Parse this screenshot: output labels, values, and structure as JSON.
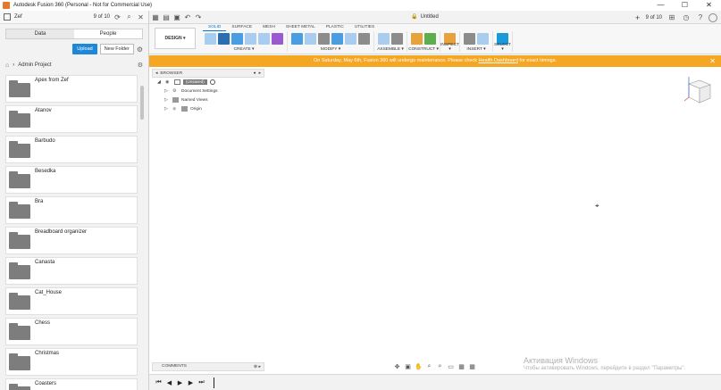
{
  "window": {
    "title": "Autodesk Fusion 360 (Personal - Not for Commercial Use)",
    "minimize": "—",
    "maximize": "☐",
    "close": "✕"
  },
  "data_panel": {
    "user": "Zef",
    "count": "9 of 10",
    "tabs": [
      "Data",
      "People"
    ],
    "upload_label": "Upload",
    "new_folder_label": "New Folder",
    "project_name": "Admin Project",
    "folders": [
      "Apex from Zef",
      "Atanov",
      "Barbudo",
      "Besedka",
      "Bra",
      "Breadboard organizer",
      "Canasta",
      "Cat_House",
      "Chess",
      "Christmas",
      "Coasters"
    ]
  },
  "document": {
    "tab_title": "Untitled",
    "count": "9 of 10"
  },
  "toolbar": {
    "design_label": "DESIGN ▾",
    "workspace_tabs": [
      "SOLID",
      "SURFACE",
      "MESH",
      "SHEET METAL",
      "PLASTIC",
      "UTILITIES"
    ],
    "groups": [
      "CREATE ▾",
      "MODIFY ▾",
      "ASSEMBLE ▾",
      "CONSTRUCT ▾",
      "INSPECT ▾",
      "INSERT ▾",
      "SELECT ▾"
    ]
  },
  "banner": {
    "text_before": "On Saturday, May 6th, Fusion 360 will undergo maintenance. Please check ",
    "link": "Health Dashboard",
    "text_after": " for exact timings."
  },
  "browser": {
    "title": "BROWSER",
    "root": "(Unsaved)",
    "items": [
      "Document Settings",
      "Named Views",
      "Origin"
    ]
  },
  "comments": {
    "title": "COMMENTS"
  },
  "activation": {
    "line1": "Активация Windows",
    "line2": "Чтобы активировать Windows, перейдите в раздел \"Параметры\"."
  },
  "colors": {
    "accent": "#1e88d8",
    "banner": "#f5a623",
    "active_tab": "#0c72c7"
  }
}
